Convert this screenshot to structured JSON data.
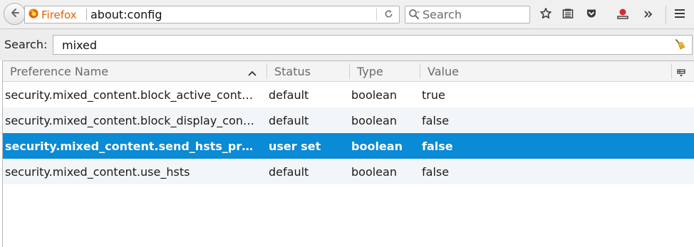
{
  "browser": {
    "identity_label": "Firefox",
    "url": "about:config",
    "search_placeholder": "Search"
  },
  "filter": {
    "label": "Search:",
    "value": "mixed"
  },
  "columns": {
    "name": "Preference Name",
    "status": "Status",
    "type": "Type",
    "value": "Value"
  },
  "rows": [
    {
      "name": "security.mixed_content.block_active_cont…",
      "status": "default",
      "type": "boolean",
      "value": "true"
    },
    {
      "name": "security.mixed_content.block_display_con…",
      "status": "default",
      "type": "boolean",
      "value": "false"
    },
    {
      "name": "security.mixed_content.send_hsts_pr…",
      "status": "user set",
      "type": "boolean",
      "value": "false"
    },
    {
      "name": "security.mixed_content.use_hsts",
      "status": "default",
      "type": "boolean",
      "value": "false"
    }
  ],
  "selected_row_index": 2,
  "colors": {
    "selection": "#0b8ad6",
    "identity": "#e66000",
    "alt_row": "#f3f6f9"
  },
  "icons": {
    "back": "back-arrow-icon",
    "firefox": "firefox-logo-icon",
    "reload": "reload-icon",
    "search": "search-icon",
    "bookmark": "bookmark-star-icon",
    "reading_list": "reading-list-icon",
    "pocket": "pocket-icon",
    "downloads": "downloads-icon",
    "overflow": "overflow-chevron-icon",
    "menu": "hamburger-menu-icon",
    "clear": "clear-filter-broom-icon",
    "sort": "sort-ascending-icon",
    "column_picker": "column-picker-icon"
  }
}
